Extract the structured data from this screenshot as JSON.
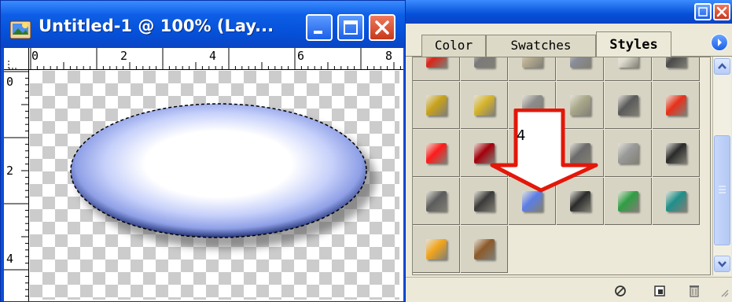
{
  "document_window": {
    "title": "Untitled-1 @ 100% (Lay...",
    "icon": "photoshop-document-icon",
    "buttons": [
      "minimize-icon",
      "maximize-icon",
      "close-icon"
    ],
    "ruler_top_labels": [
      "0",
      "2",
      "4",
      "6",
      "8"
    ],
    "ruler_left_labels": [
      "0",
      "2",
      "4"
    ]
  },
  "palette": {
    "tabs": [
      {
        "label": "Color",
        "active": false
      },
      {
        "label": "Swatches",
        "active": false
      },
      {
        "label": "Styles",
        "active": true
      }
    ],
    "menu_icon": "palette-menu-arrow-icon",
    "style_swatches": [
      {
        "name": "style-bevel-red-partial",
        "color": "#d8261a"
      },
      {
        "name": "style-bevel-gray-partial",
        "color": "#7a7a7a"
      },
      {
        "name": "style-bevel-tan-partial",
        "color": "#b7ad90"
      },
      {
        "name": "style-bevel-steel-partial",
        "color": "#8a8d99"
      },
      {
        "name": "style-bevel-light-partial",
        "color": "#e0ddd0"
      },
      {
        "name": "style-bevel-dark-partial",
        "color": "#4a4a4a"
      },
      {
        "name": "style-gold-frame",
        "color": "#c9a21a"
      },
      {
        "name": "style-gold-outline",
        "color": "#d6b42a"
      },
      {
        "name": "style-gray-chisel",
        "color": "#8c8c8c"
      },
      {
        "name": "style-olive-plate",
        "color": "#a9a88a"
      },
      {
        "name": "style-zebra-texture",
        "color": "#5a5a5a"
      },
      {
        "name": "style-red-glow",
        "color": "#e8301b"
      },
      {
        "name": "style-red-spatter",
        "color": "#ff1a1a"
      },
      {
        "name": "style-dark-red-glass",
        "color": "#a4000c"
      },
      {
        "name": "style-red-ring",
        "color": "#c01a1a"
      },
      {
        "name": "style-chrome-button",
        "color": "#6b6b6b"
      },
      {
        "name": "style-gray-gradient",
        "color": "#9a9a9a"
      },
      {
        "name": "style-black-glass",
        "color": "#2a2a2a"
      },
      {
        "name": "style-dark-gray-bevel",
        "color": "#5c5c5c"
      },
      {
        "name": "style-black-shadow",
        "color": "#3a3a3a"
      },
      {
        "name": "style-blue-glass",
        "color": "#5b7ee6"
      },
      {
        "name": "style-black-knob",
        "color": "#2b2b2b"
      },
      {
        "name": "style-green-stripes",
        "color": "#2f9e44"
      },
      {
        "name": "style-teal-stripes",
        "color": "#1f8f8a"
      },
      {
        "name": "style-orange-bevel",
        "color": "#f2a51c"
      },
      {
        "name": "style-brown-wood",
        "color": "#8c5a2b"
      }
    ],
    "status_icons": [
      "no-style-icon",
      "new-style-icon",
      "delete-style-icon"
    ],
    "scroll_icons": [
      "scroll-up-arrow-icon",
      "scroll-down-arrow-icon"
    ]
  },
  "callout": {
    "label": "4",
    "color": "#e3170a"
  },
  "canvas": {
    "shape": "ellipse-layer-blue-glow",
    "shape_color": "#3c56b8"
  }
}
